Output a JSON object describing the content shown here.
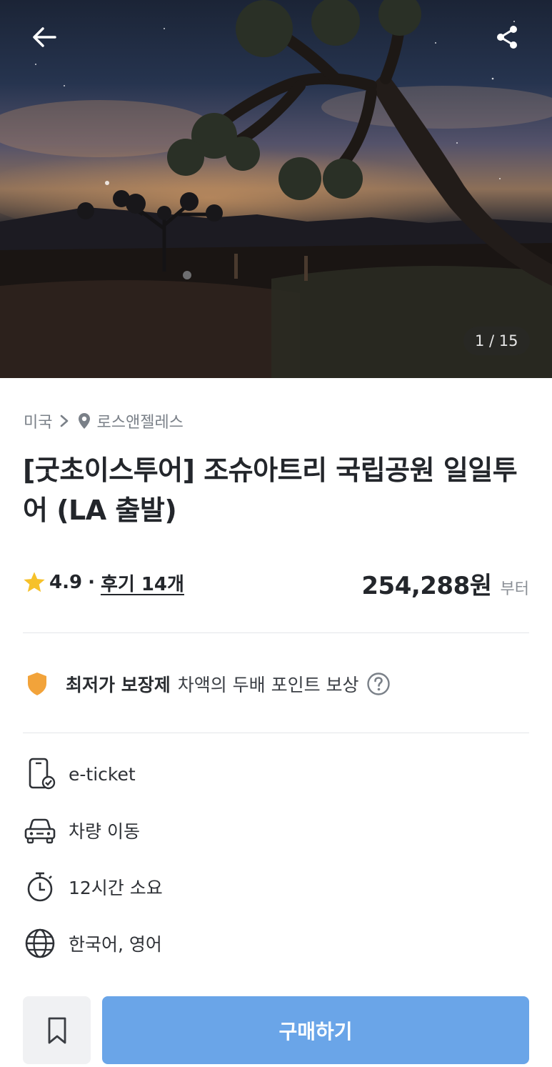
{
  "hero": {
    "image_alt": "Joshua tree under a starry desert night sky",
    "counter": "1 / 15"
  },
  "breadcrumb": {
    "country": "미국",
    "city": "로스앤젤레스"
  },
  "product": {
    "title": "[굿초이스투어] 조슈아트리 국립공원 일일투어 (LA 출발)"
  },
  "rating": {
    "score": "4.9",
    "separator": "·",
    "reviews_label": "후기 14개"
  },
  "price": {
    "amount": "254,288원",
    "suffix": "부터"
  },
  "guarantee": {
    "title": "최저가 보장제",
    "description": "차액의 두배 포인트 보상"
  },
  "features": [
    {
      "icon": "e-ticket-icon",
      "label": "e-ticket"
    },
    {
      "icon": "car-icon",
      "label": "차량 이동"
    },
    {
      "icon": "stopwatch-icon",
      "label": "12시간 소요"
    },
    {
      "icon": "globe-icon",
      "label": "한국어, 영어"
    }
  ],
  "actions": {
    "buy_label": "구매하기"
  },
  "colors": {
    "accent": "#6aa5e8",
    "star": "#f6c12a",
    "shield": "#f2a33a",
    "text": "#23262b",
    "muted": "#7a8088"
  }
}
